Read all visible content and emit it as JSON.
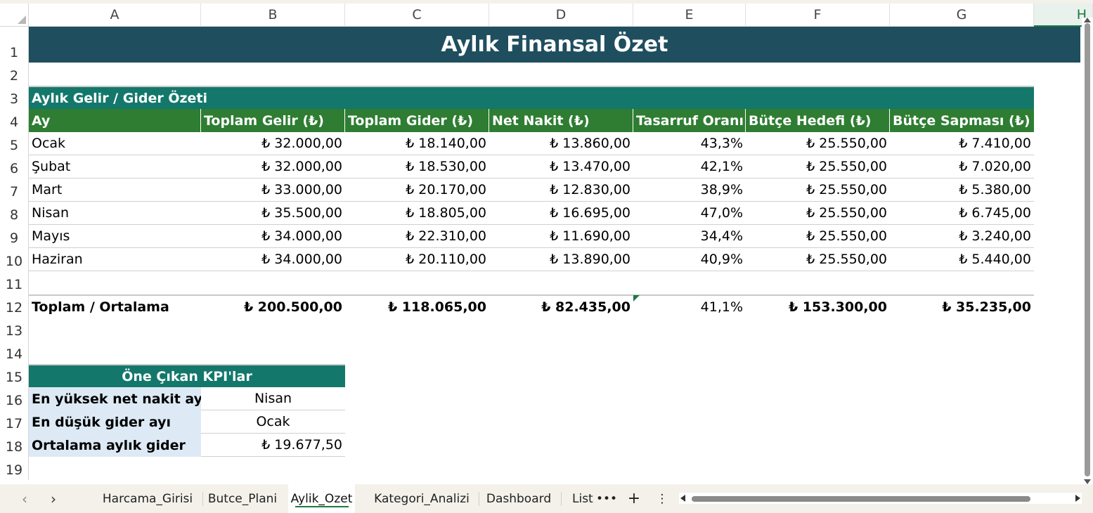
{
  "columns": [
    "A",
    "B",
    "C",
    "D",
    "E",
    "F",
    "G",
    "H"
  ],
  "rows": [
    "1",
    "2",
    "3",
    "4",
    "5",
    "6",
    "7",
    "8",
    "9",
    "10",
    "11",
    "12",
    "13",
    "14",
    "15",
    "16",
    "17",
    "18",
    "19"
  ],
  "title": "Aylık Finansal Özet",
  "section_title": "Aylık Gelir / Gider Özeti",
  "headers": [
    "Ay",
    "Toplam Gelir (₺)",
    "Toplam Gider (₺)",
    "Net Nakit (₺)",
    "Tasarruf Oranı",
    "Bütçe Hedefi (₺)",
    "Bütçe Sapması (₺)"
  ],
  "data_rows": [
    [
      "Ocak",
      "₺ 32.000,00",
      "₺ 18.140,00",
      "₺ 13.860,00",
      "43,3%",
      "₺ 25.550,00",
      "₺ 7.410,00"
    ],
    [
      "Şubat",
      "₺ 32.000,00",
      "₺ 18.530,00",
      "₺ 13.470,00",
      "42,1%",
      "₺ 25.550,00",
      "₺ 7.020,00"
    ],
    [
      "Mart",
      "₺ 33.000,00",
      "₺ 20.170,00",
      "₺ 12.830,00",
      "38,9%",
      "₺ 25.550,00",
      "₺ 5.380,00"
    ],
    [
      "Nisan",
      "₺ 35.500,00",
      "₺ 18.805,00",
      "₺ 16.695,00",
      "47,0%",
      "₺ 25.550,00",
      "₺ 6.745,00"
    ],
    [
      "Mayıs",
      "₺ 34.000,00",
      "₺ 22.310,00",
      "₺ 11.690,00",
      "34,4%",
      "₺ 25.550,00",
      "₺ 3.240,00"
    ],
    [
      "Haziran",
      "₺ 34.000,00",
      "₺ 20.110,00",
      "₺ 13.890,00",
      "40,9%",
      "₺ 25.550,00",
      "₺ 5.440,00"
    ]
  ],
  "total_row": [
    "Toplam / Ortalama",
    "₺ 200.500,00",
    "₺ 118.065,00",
    "₺ 82.435,00",
    "41,1%",
    "₺ 153.300,00",
    "₺ 35.235,00"
  ],
  "kpi": {
    "title": "Öne Çıkan KPI'lar",
    "items": [
      {
        "label": "En yüksek net nakit ayı",
        "value": "Nisan"
      },
      {
        "label": "En düşük gider ayı",
        "value": "Ocak"
      },
      {
        "label": "Ortalama aylık gider",
        "value": "₺ 19.677,50"
      }
    ]
  },
  "tabs": [
    "Harcama_Girisi",
    "Butce_Plani",
    "Aylik_Ozet",
    "Kategori_Analizi",
    "Dashboard",
    "Liste"
  ],
  "active_tab": "Aylik_Ozet",
  "tab_more": "•••",
  "tab_add": "+",
  "tab_menu": "⋮",
  "nav_prev": "‹",
  "nav_next": "›",
  "colors": {
    "title_band": "#1f4e5f",
    "section": "#13786b",
    "header": "#2e7d32",
    "kpi_label_bg": "#ddeaf5"
  }
}
